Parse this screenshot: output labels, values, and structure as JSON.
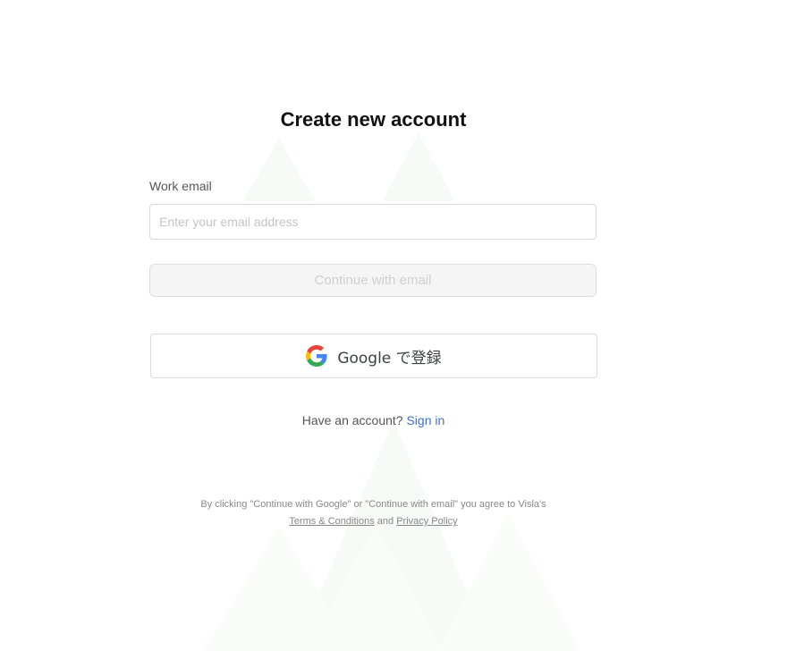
{
  "title": "Create new account",
  "email_field": {
    "label": "Work email",
    "placeholder": "Enter your email address",
    "value": ""
  },
  "continue_button": {
    "label": "Continue with email",
    "disabled": true
  },
  "google_button": {
    "label": "Google で登録",
    "icon": "google-g-logo"
  },
  "signin": {
    "prompt": "Have an account?",
    "link_label": "Sign in"
  },
  "legal": {
    "notice": "By clicking \"Continue with Google\" or \"Continue with email\" you agree to Visla's",
    "terms_label": "Terms & Conditions",
    "and_text": "and",
    "privacy_label": "Privacy Policy"
  },
  "colors": {
    "link": "#3b73c8",
    "title": "#111111",
    "background_decor": "#f6faf6"
  }
}
